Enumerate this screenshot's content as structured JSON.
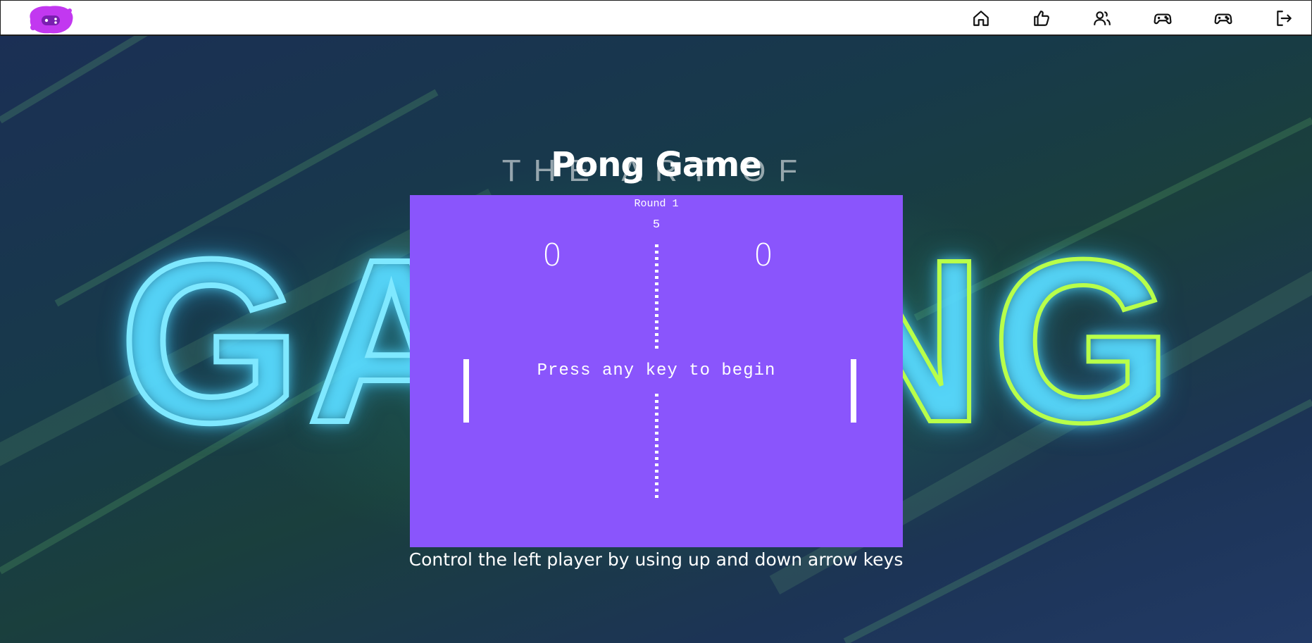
{
  "nav": {
    "items": [
      {
        "name": "home-icon"
      },
      {
        "name": "thumbs-up-icon"
      },
      {
        "name": "friends-icon"
      },
      {
        "name": "gamepad-icon"
      },
      {
        "name": "gamepad-alt-icon"
      },
      {
        "name": "logout-icon"
      }
    ]
  },
  "background": {
    "headline_left": "GA",
    "headline_right": "NG",
    "ghost_line": "THE ART OF"
  },
  "game": {
    "title": "Pong Game",
    "round_label": "Round 1",
    "timer": "5",
    "score_left": "0",
    "score_right": "0",
    "prompt": "Press any key to begin",
    "instructions": "Control the left player by using up and down arrow keys"
  },
  "colors": {
    "court": "#8a55fc",
    "logo": "#c238f0",
    "accent_green": "#b8ff4a",
    "accent_cyan": "#7fe8ff"
  }
}
